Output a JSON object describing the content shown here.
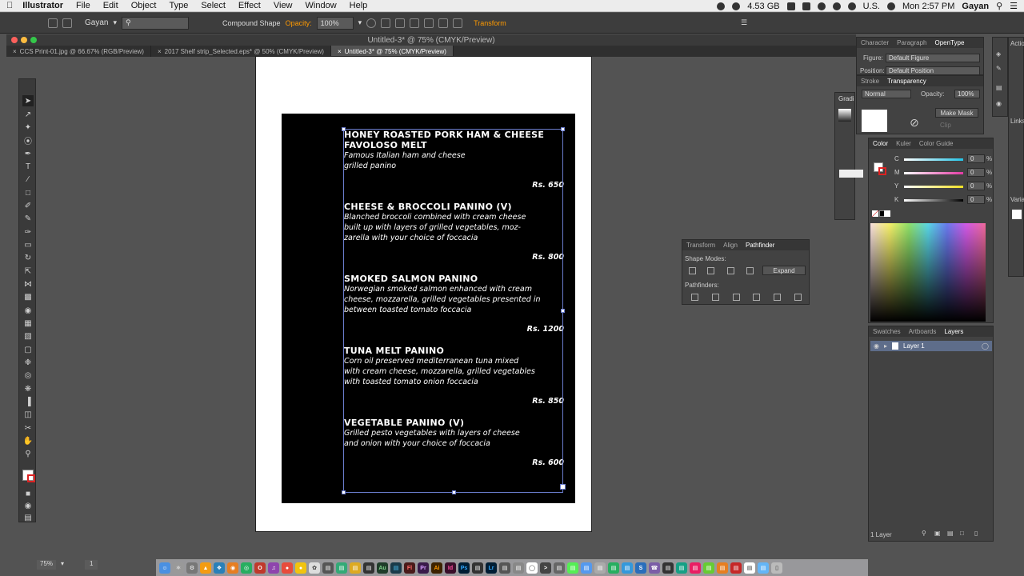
{
  "menubar": {
    "app": "Illustrator",
    "items": [
      "File",
      "Edit",
      "Object",
      "Type",
      "Select",
      "Effect",
      "View",
      "Window",
      "Help"
    ],
    "memory": "4.53 GB",
    "locale": "U.S.",
    "clock": "Mon 2:57 PM",
    "user": "Gayan"
  },
  "control_bar": {
    "logo": "Ai",
    "workspace": "Gayan",
    "selection_label": "Compound Shape",
    "opacity_label": "Opacity:",
    "opacity_value": "100%",
    "transform_link": "Transform"
  },
  "window": {
    "title": "Untitled-3* @ 75% (CMYK/Preview)"
  },
  "tabs": [
    {
      "label": "CCS Print-01.jpg @ 66.67% (RGB/Preview)",
      "active": false
    },
    {
      "label": "2017 Shelf strip_Selected.eps* @ 50% (CMYK/Preview)",
      "active": false
    },
    {
      "label": "Untitled-3* @ 75% (CMYK/Preview)",
      "active": true
    }
  ],
  "menu_items": [
    {
      "title": "HONEY ROASTED PORK HAM & CHEESE",
      "title2": "FAVOLOSO MELT",
      "desc": [
        "Famous Italian ham and cheese",
        "grilled panino"
      ],
      "price": "Rs. 650"
    },
    {
      "title": "CHEESE & BROCCOLI PANINO (V)",
      "title2": "",
      "desc": [
        "Blanched broccoli combined with cream cheese",
        "built up with layers of grilled vegetables, moz-",
        "zarella with your choice of foccacia"
      ],
      "price": "Rs. 800"
    },
    {
      "title": "SMOKED SALMON PANINO",
      "title2": "",
      "desc": [
        "Norwegian smoked salmon enhanced with cream",
        "cheese, mozzarella, grilled vegetables presented in",
        "between toasted tomato foccacia"
      ],
      "price": "Rs. 1200"
    },
    {
      "title": "TUNA MELT PANINO",
      "title2": "",
      "desc": [
        "Corn oil preserved mediterranean tuna mixed",
        "with cream cheese, mozzarella, grilled vegetables",
        "with toasted tomato onion foccacia"
      ],
      "price": "Rs. 850"
    },
    {
      "title": "VEGETABLE PANINO (V)",
      "title2": "",
      "desc": [
        "Grilled pesto vegetables with layers of cheese",
        "and onion with your choice of foccacia"
      ],
      "price": "Rs. 600"
    }
  ],
  "panels": {
    "opentype": {
      "tabs": [
        "Character",
        "Paragraph",
        "OpenType"
      ],
      "figure_label": "Figure:",
      "figure_value": "Default Figure",
      "position_label": "Position:",
      "position_value": "Default Position"
    },
    "transparency": {
      "tabs": [
        "Stroke",
        "Transparency"
      ],
      "blend_mode": "Normal",
      "opacity_label": "Opacity:",
      "opacity_value": "100%",
      "make_mask": "Make Mask",
      "clip": "Clip"
    },
    "gradient_tab": "Gradi",
    "color": {
      "tabs": [
        "Color",
        "Kuler",
        "Color Guide"
      ],
      "channels": [
        {
          "label": "C",
          "value": "0",
          "color": "#24c3e6"
        },
        {
          "label": "M",
          "value": "0",
          "color": "#e23aa4"
        },
        {
          "label": "Y",
          "value": "0",
          "color": "#f0e025"
        },
        {
          "label": "K",
          "value": "0",
          "color": "#9a9a9a"
        }
      ],
      "pct": "%"
    },
    "pathfinder": {
      "tabs": [
        "Transform",
        "Align",
        "Pathfinder"
      ],
      "shape_modes": "Shape Modes:",
      "pathfinders": "Pathfinders:",
      "expand": "Expand"
    },
    "layers": {
      "tabs": [
        "Swatches",
        "Artboards",
        "Layers"
      ],
      "layer_name": "Layer 1",
      "footer": "1 Layer"
    },
    "side_tabs": [
      "Actio",
      "Links",
      "Varia"
    ]
  },
  "status": {
    "zoom": "75%",
    "page": "1"
  },
  "accent_color": "#ff9a00"
}
